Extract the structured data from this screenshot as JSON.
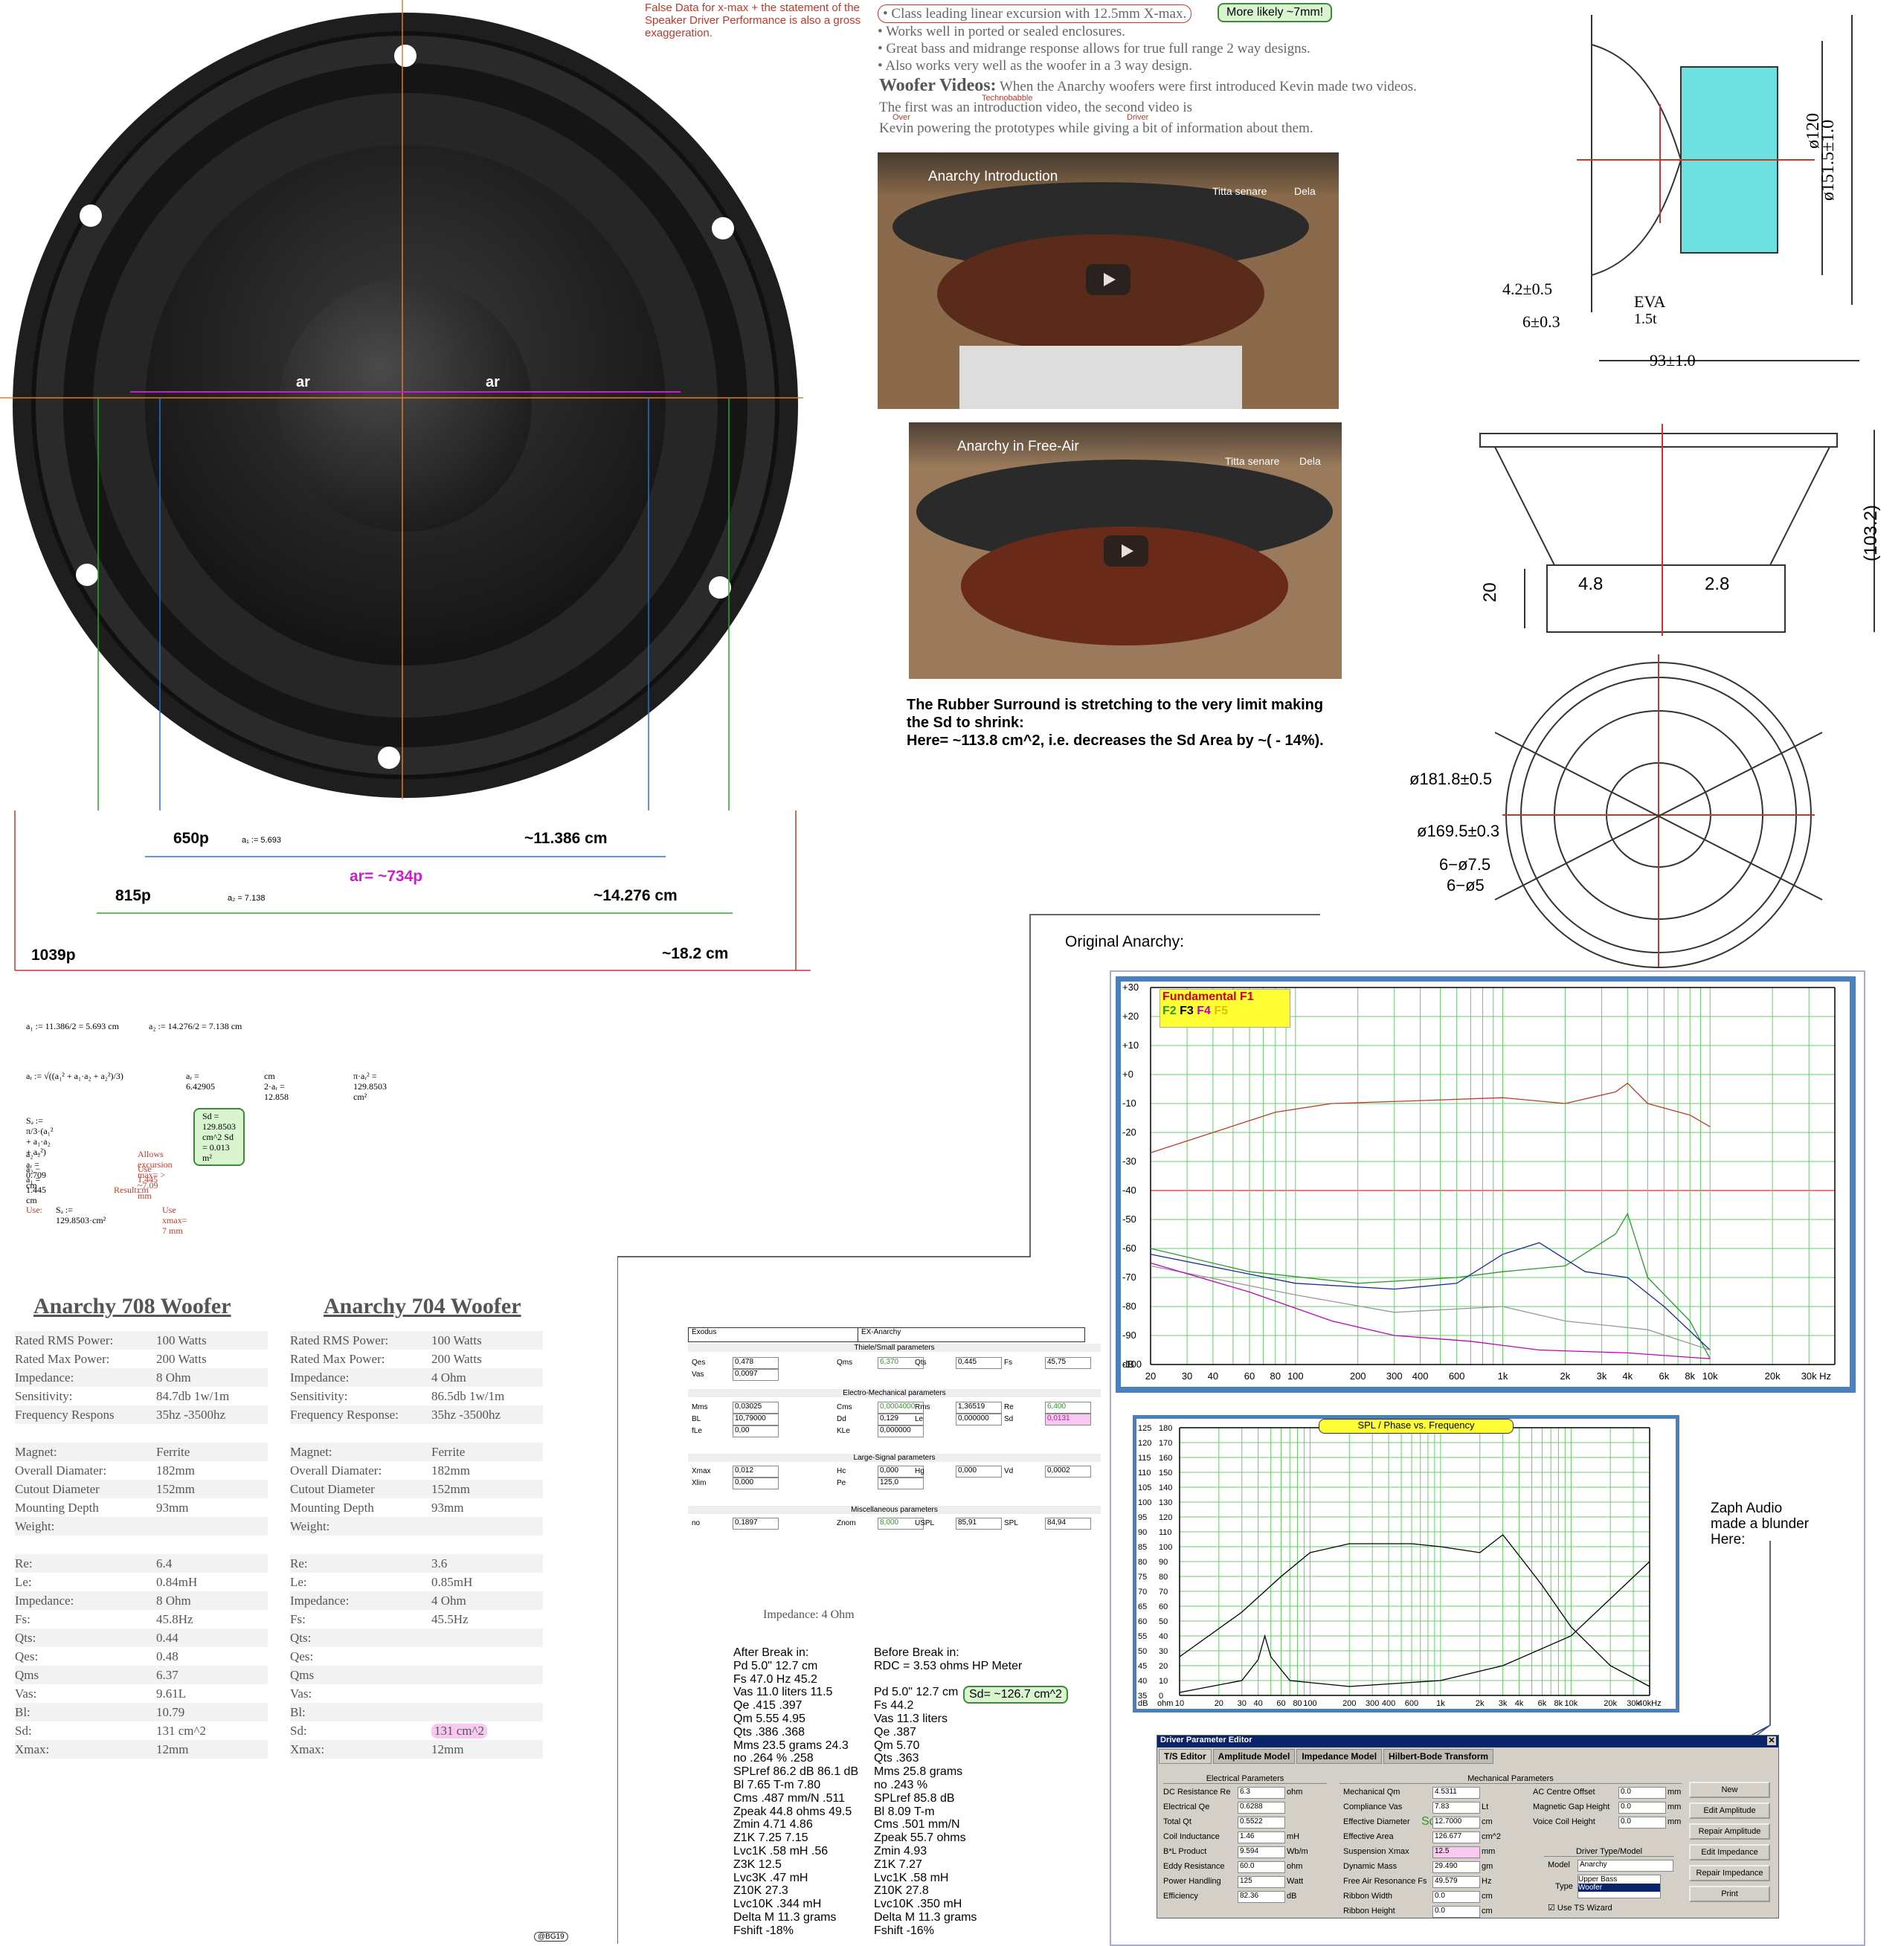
{
  "woofer_photo": {
    "ar_left": "ar",
    "ar_right": "ar",
    "m650": "650p",
    "a1_eq": "a₁ := 5.693",
    "cm11": "~11.386 cm",
    "ar_px": "ar= ~734p",
    "m815": "815p",
    "a2_eq": "a₂ = 7.138",
    "cm14": "~14.276 cm",
    "m1039": "1039p",
    "cm18": "~18.2 cm"
  },
  "false_data_note": "False Data for x-max + the statement of the Speaker Driver Performance is also a gross exaggeration.",
  "bullets": [
    "Class leading linear excursion with 12.5mm X-max.",
    "Works well in ported or sealed enclosures.",
    "Great bass and midrange response allows for true full range 2 way designs.",
    "Also works very well as the woofer in a 3 way design."
  ],
  "more_likely": "More likely ~7mm!",
  "woofer_videos": {
    "heading": "Woofer Videos:",
    "line1": "When the Anarchy woofers were first introduced Kevin made two videos.",
    "line2": "The first was an introduction video, the second video is",
    "line3": "Kevin powering the prototypes while giving a bit of information about them.",
    "tag_technobabble": "Technobabble",
    "tag_over": "Over",
    "tag_driver": "Driver"
  },
  "videos": [
    {
      "title": "Anarchy Introduction",
      "watch": "Titta senare",
      "share": "Dela"
    },
    {
      "title": "Anarchy in Free-Air",
      "watch": "Titta senare",
      "share": "Dela"
    }
  ],
  "rubber_note": {
    "line1": "The Rubber Surround is stretching to the very limit making",
    "line2": "the Sd to shrink:",
    "line3": "Here= ~113.8 cm^2,  i.e. decreases the Sd Area by ~( - 14%)."
  },
  "drawing": {
    "d120": "ø120",
    "d151": "ø151.5±1.0",
    "d4": "4.2±0.5",
    "eva": "EVA",
    "eva_t": "1.5t",
    "d6": "6±0.3",
    "d93": "93±1.0",
    "h103": "(103.2)",
    "h20": "20",
    "w48": "4.8",
    "w28": "2.8",
    "d181": "ø181.8±0.5",
    "d169": "ø169.5±0.3",
    "h75": "6−ø7.5",
    "h5": "6−ø5"
  },
  "calc": {
    "a1": "a₁ := 11.386/2 = 5.693  cm",
    "a2": "a₂ := 14.276/2 = 7.138  cm",
    "ar": "aᵣ := √((a₁² + a₁·a₂ + a₂²)/3)",
    "ar_val": "aᵣ = 6.42905",
    "cm2": "cm  2·aᵣ = 12.858",
    "pi_ar": "π·aᵣ² = 129.8503  cm²",
    "sd_eq": "Sₔ := π/3·(a₁² + a₁·a₂ + a₂²)",
    "sd_box": "Sd =  129.8503 cm^2    Sd = 0.013 m²",
    "a2_ar": "a₂ − aᵣ = 0.709     cm",
    "allows": "Allows excursion max= > ~7.09 mm",
    "a2_a1": "a₂ − a₁ = 1.445     cm",
    "use145": "Use 1.445 cm",
    "result": "Result:",
    "use": "Use:",
    "use_sd": "Sₔ := 129.8503·cm²",
    "use_xmax": "Use xmax= 7 mm"
  },
  "original_anarchy": "Original Anarchy:",
  "fft": {
    "legend_title": "Fundamental F1",
    "f2": "F2",
    "f3": "F3",
    "f4": "F4",
    "f5": "F5",
    "y_ticks": [
      "+30",
      "+20",
      "+10",
      "+0",
      "-10",
      "-20",
      "-30",
      "-40",
      "-50",
      "-60",
      "-70",
      "-80",
      "-90",
      "-100",
      "dB"
    ],
    "x_ticks": [
      "20",
      "30",
      "40",
      "60",
      "80",
      "100",
      "200",
      "300",
      "400",
      "600",
      "1k",
      "2k",
      "3k",
      "4k",
      "6k",
      "8k",
      "10k",
      "20k",
      "30k",
      "Hz"
    ]
  },
  "spl": {
    "title": "SPL / Phase vs. Frequency",
    "y1": [
      "125",
      "120",
      "115",
      "110",
      "105",
      "100",
      "95",
      "90",
      "85",
      "80",
      "75",
      "70",
      "65",
      "60",
      "55",
      "50",
      "45",
      "40",
      "35",
      "dB"
    ],
    "y2": [
      "180",
      "170",
      "160",
      "150",
      "140",
      "130",
      "120",
      "110",
      "100",
      "90",
      "80",
      "70",
      "60",
      "50",
      "40",
      "30",
      "20",
      "10",
      "0",
      "ohm"
    ],
    "x_ticks": [
      "10",
      "20",
      "30",
      "40",
      "60",
      "80",
      "100",
      "200",
      "300",
      "400",
      "600",
      "1k",
      "2k",
      "3k",
      "4k",
      "6k",
      "8k",
      "10k",
      "20k",
      "30k",
      "40kHz"
    ]
  },
  "zaph_note": "Zaph Audio\nmade a blunder\nHere:",
  "anarchy_708": {
    "title": "Anarchy 708 Woofer",
    "rows": [
      [
        "Rated RMS Power:",
        "100 Watts"
      ],
      [
        "Rated Max Power:",
        "200 Watts"
      ],
      [
        "Impedance:",
        "8 Ohm"
      ],
      [
        "Sensitivity:",
        "84.7db 1w/1m"
      ],
      [
        "Frequency Respons",
        "35hz -3500hz"
      ],
      [
        "",
        ""
      ],
      [
        "Magnet:",
        "Ferrite"
      ],
      [
        "Overall Diamater:",
        "182mm"
      ],
      [
        "Cutout Diameter",
        "152mm"
      ],
      [
        "Mounting Depth",
        "93mm"
      ],
      [
        "Weight:",
        ""
      ],
      [
        "",
        ""
      ],
      [
        "Re:",
        "6.4"
      ],
      [
        "Le:",
        "0.84mH"
      ],
      [
        "Impedance:",
        "8 Ohm"
      ],
      [
        "Fs:",
        "45.8Hz"
      ],
      [
        "Qts:",
        "0.44"
      ],
      [
        "Qes:",
        "0.48"
      ],
      [
        "Qms",
        "6.37"
      ],
      [
        "Vas:",
        "9.61L"
      ],
      [
        "Bl:",
        "10.79"
      ],
      [
        "Sd:",
        "131 cm^2"
      ],
      [
        "Xmax:",
        "12mm"
      ]
    ]
  },
  "anarchy_704": {
    "title": "Anarchy 704 Woofer",
    "rows": [
      [
        "Rated RMS Power:",
        "100 Watts"
      ],
      [
        "Rated Max Power:",
        "200 Watts"
      ],
      [
        "Impedance:",
        "4 Ohm"
      ],
      [
        "Sensitivity:",
        "86.5db 1w/1m"
      ],
      [
        "Frequency Response:",
        "35hz -3500hz"
      ],
      [
        "",
        ""
      ],
      [
        "Magnet:",
        "Ferrite"
      ],
      [
        "Overall Diamater:",
        "182mm"
      ],
      [
        "Cutout Diameter",
        "152mm"
      ],
      [
        "Mounting Depth",
        "93mm"
      ],
      [
        "Weight:",
        ""
      ],
      [
        "",
        ""
      ],
      [
        "Re:",
        "3.6"
      ],
      [
        "Le:",
        "0.85mH"
      ],
      [
        "Impedance:",
        "4 Ohm"
      ],
      [
        "Fs:",
        "45.5Hz"
      ],
      [
        "Qts:",
        ""
      ],
      [
        "Qes:",
        ""
      ],
      [
        "Qms",
        ""
      ],
      [
        "Vas:",
        ""
      ],
      [
        "Bl:",
        ""
      ],
      [
        "Sd:",
        "131 cm^2"
      ],
      [
        "Xmax:",
        "12mm"
      ]
    ]
  },
  "exodus": {
    "brand": "Exodus",
    "model": "EX-Anarchy",
    "s1": "Thiele/Small parameters",
    "s2": "Electro-Mechanical parameters",
    "s3": "Large-Signal parameters",
    "s4": "Miscellaneous parameters",
    "fields": [
      [
        "Qes",
        "0,478"
      ],
      [
        "Qms",
        "6,370"
      ],
      [
        "Qts",
        "0,445"
      ],
      [
        "Fs",
        "45,75"
      ],
      [
        "Vas",
        "0,0097"
      ],
      [
        "Mms",
        "0,03025"
      ],
      [
        "Cms",
        "0,0004000"
      ],
      [
        "Rms",
        "1,36519"
      ],
      [
        "Re",
        "6,400"
      ],
      [
        "BL",
        "10,79000"
      ],
      [
        "Dd",
        "0,129"
      ],
      [
        "Le",
        "0,000000"
      ],
      [
        "Sd",
        "0,0131"
      ],
      [
        "fLe",
        "0,00"
      ],
      [
        "KLe",
        "0,000000"
      ],
      [
        "Xmax",
        "0,012"
      ],
      [
        "Hc",
        "0,000"
      ],
      [
        "Hg",
        "0,000"
      ],
      [
        "Vd",
        "0,0002"
      ],
      [
        "Xlim",
        "0,000"
      ],
      [
        "Pe",
        "125,0"
      ],
      [
        "no",
        "0,1897"
      ],
      [
        "Znom",
        "8,000"
      ],
      [
        "USPL",
        "85,91"
      ],
      [
        "SPL",
        "84,94"
      ]
    ]
  },
  "impedance_4ohm": "Impedance:  4 Ohm",
  "after_break": "After Break in:\nPd 5.0\" 12.7 cm\nFs 47.0 Hz 45.2\nVas 11.0 liters 11.5\nQe .415 .397\nQm 5.55 4.95\nQts .386 .368\nMms 23.5 grams 24.3\nno .264 % .258\nSPLref 86.2 dB 86.1 dB\nBl 7.65 T-m 7.80\nCms .487 mm/N .511\nZpeak 44.8 ohms 49.5\nZmin 4.71 4.86\nZ1K 7.25 7.15\nLvc1K .58 mH .56\nZ3K 12.5\nLvc3K .47 mH\nZ10K 27.3\nLvc10K .344 mH\nDelta M 11.3 grams\nFshift -18%",
  "before_break": "Before Break in:\nRDC = 3.53 ohms HP Meter\n\nPd 5.0\" 12.7 cm\nFs 44.2\nVas 11.3 liters\nQe .387\nQm 5.70\nQts .363\nMms 25.8 grams\nno .243 %\nSPLref 85.8 dB\nBl 8.09 T-m\nCms .501 mm/N\nZpeak 55.7 ohms\nZmin 4.93\nZ1K 7.27\nLvc1K .58 mH\nZ10K 27.8\nLvc10K .350 mH\nDelta M 11.3 grams\nFshift -16%",
  "sd_pill": "Sd= ~126.7 cm^2",
  "signature": "@BG19",
  "dpe": {
    "title": "Driver Parameter Editor",
    "tabs": [
      "T/S Editor",
      "Amplitude Model",
      "Impedance Model",
      "Hilbert-Bode Transform"
    ],
    "elec_title": "Electrical Parameters",
    "mech_title": "Mechanical Parameters",
    "elec": [
      [
        "DC Resistance Re",
        "6.3",
        "ohm"
      ],
      [
        "Electrical Qe",
        "0.6288",
        ""
      ],
      [
        "Total Qt",
        "0.5522",
        ""
      ],
      [
        "Coil Inductance",
        "1.46",
        "mH"
      ],
      [
        "B*L Product",
        "9.594",
        "Wb/m"
      ],
      [
        "Eddy Resistance",
        "60.0",
        "ohm"
      ],
      [
        "Power Handling",
        "125",
        "Watt"
      ],
      [
        "Efficiency",
        "82.36",
        "dB"
      ]
    ],
    "mech": [
      [
        "Mechanical Qm",
        "4.5311",
        ""
      ],
      [
        "Compliance Vas",
        "7.83",
        "Lt"
      ],
      [
        "Effective Diameter",
        "12.7000",
        "cm"
      ],
      [
        "Effective Area",
        "126.677",
        "cm^2"
      ],
      [
        "Suspension Xmax",
        "12.5",
        "mm"
      ],
      [
        "Dynamic Mass",
        "29.490",
        "gm"
      ],
      [
        "Free Air Resonance Fs",
        "49.579",
        "Hz"
      ],
      [
        "Ribbon Width",
        "0.0",
        "cm"
      ],
      [
        "Ribbon Height",
        "0.0",
        "cm"
      ]
    ],
    "extra": [
      [
        "AC Centre Offset",
        "0.0",
        "mm"
      ],
      [
        "Magnetic Gap Height",
        "0.0",
        "mm"
      ],
      [
        "Voice Coil Height",
        "0.0",
        "mm"
      ]
    ],
    "buttons": [
      "New",
      "Edit Amplitude",
      "Repair Amplitude",
      "Edit Impedance",
      "Repair Impedance",
      "Print"
    ],
    "type_title": "Driver Type/Model",
    "model_label": "Model",
    "model": "Anarchy",
    "type_label": "Type",
    "type1": "Upper Bass",
    "type2": "Woofer",
    "use_wizard": "Use TS Wizard",
    "sd_tag": "Sd:"
  },
  "colors": {
    "red": "#c0392b",
    "magenta": "#d01ad0",
    "green_pill": "#d8f5d0",
    "fft_bg": "#ffffff",
    "fft_frame": "#4a7fc0"
  }
}
